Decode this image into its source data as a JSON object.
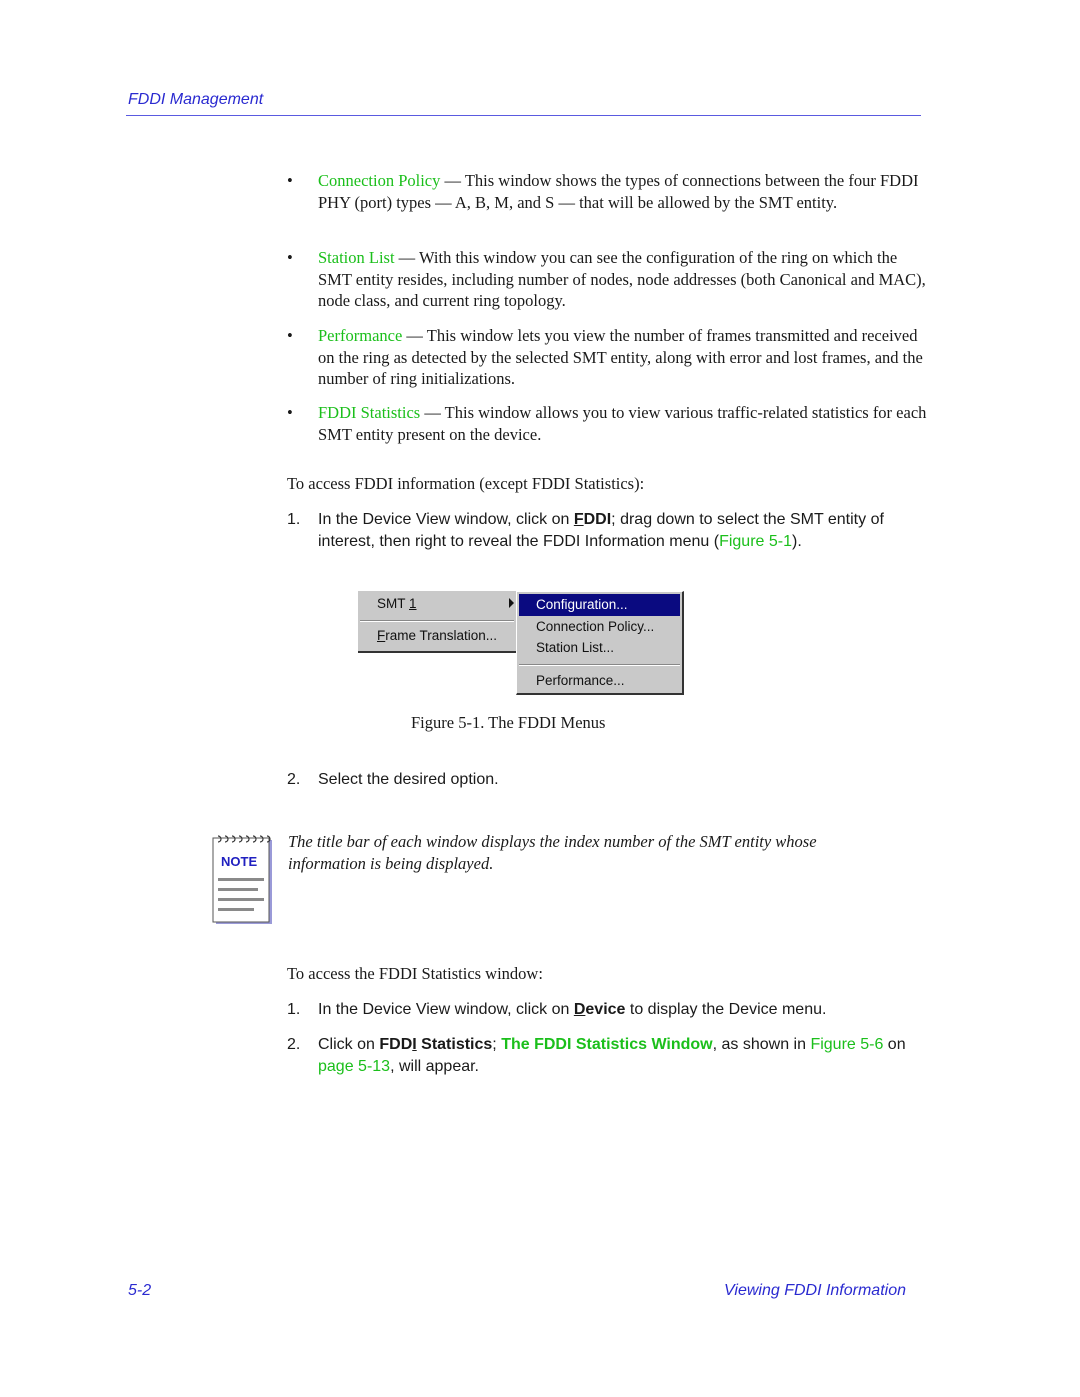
{
  "header": {
    "title": "FDDI Management"
  },
  "bullets": [
    {
      "term": "Connection Policy",
      "text": " — This window shows the types of connections between the four FDDI PHY (port) types — A, B, M, and S — that will be allowed by the SMT entity."
    },
    {
      "term": "Station List",
      "text": " — With this window you can see the configuration of the ring on which the SMT entity resides, including number of nodes, node addresses (both Canonical and MAC), node class, and current ring topology."
    },
    {
      "term": "Performance",
      "text": " — This window lets you view the number of frames transmitted and received on the ring as detected by the selected SMT entity, along with error and lost frames, and the number of ring initializations."
    },
    {
      "term": "FDDI Statistics",
      "text": " — This window allows you to view various traffic-related statistics for each SMT entity present on the device."
    }
  ],
  "bullet_glyph": "•",
  "intro1": "To access FDDI information (except FDDI Statistics):",
  "steps1": [
    {
      "num": "1.",
      "pre": "In the Device View window, click on ",
      "bold_ul": "F",
      "bold": "DDI",
      "post": "; drag down to select the SMT entity of interest, then right to reveal the FDDI Information menu (",
      "link": "Figure 5-1",
      "end": ")."
    },
    {
      "num": "2.",
      "text": "Select the desired option."
    }
  ],
  "menu": {
    "left_items": [
      {
        "label_pre": "SMT ",
        "label_ul": "1",
        "label_post": "",
        "has_submenu": true
      },
      {
        "label_pre": "",
        "label_ul": "F",
        "label_post": "rame Translation...",
        "has_submenu": false
      }
    ],
    "right_items": [
      {
        "label": "Configuration...",
        "highlighted": true
      },
      {
        "label": "Connection Policy...",
        "highlighted": false
      },
      {
        "label": "Station List...",
        "highlighted": false
      },
      {
        "label": "Performance...",
        "highlighted": false
      }
    ],
    "highlight_color": "#0a0a80"
  },
  "figure_caption": "Figure 5-1.  The FDDI Menus",
  "note": {
    "icon_label": "NOTE",
    "text": "The title bar of each window displays the index number of the SMT entity whose information is being displayed."
  },
  "intro2": "To access the FDDI Statistics window:",
  "steps2": [
    {
      "num": "1.",
      "pre": "In the Device View window, click on ",
      "bold_ul": "D",
      "bold": "evice",
      "post": " to display the Device menu."
    },
    {
      "num": "2.",
      "pre": "Click on ",
      "bold_a": "FDD",
      "bold_ul": "I",
      "bold_b": " Statistics",
      "mid": "; ",
      "link1": "The FDDI Statistics Window",
      "mid2": ", as shown in ",
      "link2": "Figure 5-6",
      "mid3": " on ",
      "link3": "page 5-13",
      "end": ", will appear."
    }
  ],
  "footer": {
    "page_number": "5-2",
    "section": "Viewing FDDI Information"
  },
  "colors": {
    "header_blue": "#2a2ad0",
    "link_green": "#1bbf1b"
  }
}
